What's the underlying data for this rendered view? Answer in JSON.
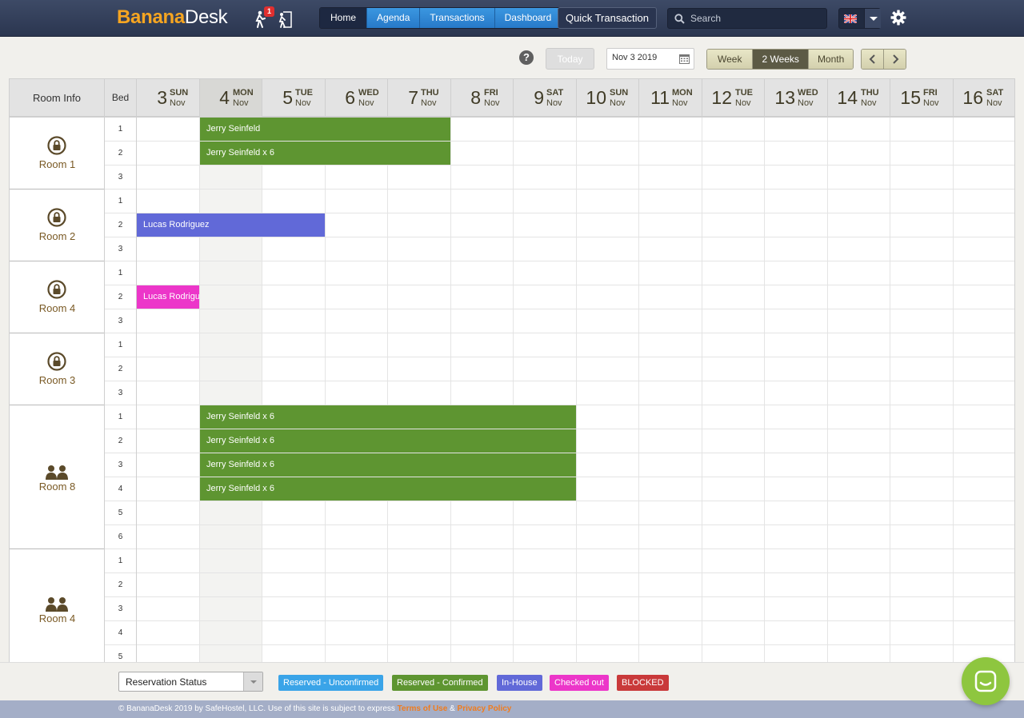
{
  "brand": {
    "part1": "Banana",
    "part2": "Desk"
  },
  "header": {
    "arrivals_badge": "1",
    "nav": [
      {
        "label": "Home",
        "active": true
      },
      {
        "label": "Agenda",
        "active": false
      },
      {
        "label": "Transactions",
        "active": false
      },
      {
        "label": "Dashboard",
        "active": false
      }
    ],
    "quick_transaction": "Quick Transaction",
    "search_placeholder": "Search",
    "language_icon": "uk-flag-icon"
  },
  "toolbar": {
    "help": "?",
    "today": "Today",
    "date_value": "Nov 3 2019",
    "views": [
      {
        "label": "Week",
        "active": false
      },
      {
        "label": "2 Weeks",
        "active": true
      },
      {
        "label": "Month",
        "active": false
      }
    ]
  },
  "calendar": {
    "room_info_header": "Room Info",
    "bed_header": "Bed",
    "days": [
      {
        "num": "3",
        "dow": "SUN",
        "mon": "Nov",
        "today": false
      },
      {
        "num": "4",
        "dow": "MON",
        "mon": "Nov",
        "today": true
      },
      {
        "num": "5",
        "dow": "TUE",
        "mon": "Nov",
        "today": false
      },
      {
        "num": "6",
        "dow": "WED",
        "mon": "Nov",
        "today": false
      },
      {
        "num": "7",
        "dow": "THU",
        "mon": "Nov",
        "today": false
      },
      {
        "num": "8",
        "dow": "FRI",
        "mon": "Nov",
        "today": false
      },
      {
        "num": "9",
        "dow": "SAT",
        "mon": "Nov",
        "today": false
      },
      {
        "num": "10",
        "dow": "SUN",
        "mon": "Nov",
        "today": false
      },
      {
        "num": "11",
        "dow": "MON",
        "mon": "Nov",
        "today": false
      },
      {
        "num": "12",
        "dow": "TUE",
        "mon": "Nov",
        "today": false
      },
      {
        "num": "13",
        "dow": "WED",
        "mon": "Nov",
        "today": false
      },
      {
        "num": "14",
        "dow": "THU",
        "mon": "Nov",
        "today": false
      },
      {
        "num": "15",
        "dow": "FRI",
        "mon": "Nov",
        "today": false
      },
      {
        "num": "16",
        "dow": "SAT",
        "mon": "Nov",
        "today": false
      }
    ],
    "rooms": [
      {
        "name": "Room 1",
        "icon": "lock-icon",
        "beds": [
          "1",
          "2",
          "3"
        ]
      },
      {
        "name": "Room 2",
        "icon": "lock-icon",
        "beds": [
          "1",
          "2",
          "3"
        ]
      },
      {
        "name": "Room 4",
        "icon": "lock-icon",
        "beds": [
          "1",
          "2",
          "3"
        ]
      },
      {
        "name": "Room 3",
        "icon": "lock-icon",
        "beds": [
          "1",
          "2",
          "3"
        ]
      },
      {
        "name": "Room 8",
        "icon": "people-icon",
        "beds": [
          "1",
          "2",
          "3",
          "4",
          "5",
          "6"
        ]
      },
      {
        "name": "Room 4",
        "icon": "people-icon",
        "beds": [
          "1",
          "2",
          "3",
          "4",
          "5"
        ]
      }
    ],
    "reservations": [
      {
        "guest": "Jerry Seinfeld",
        "room": 0,
        "bed": 0,
        "start_day": 1,
        "days": 4,
        "status": "confirmed"
      },
      {
        "guest": "Jerry Seinfeld x 6",
        "room": 0,
        "bed": 1,
        "start_day": 1,
        "days": 4,
        "status": "confirmed"
      },
      {
        "guest": "Lucas Rodriguez",
        "room": 1,
        "bed": 1,
        "start_day": 0,
        "days": 3,
        "status": "inhouse"
      },
      {
        "guest": "Lucas Rodriguez",
        "room": 2,
        "bed": 1,
        "start_day": 0,
        "days": 1,
        "status": "checkedout"
      },
      {
        "guest": "Jerry Seinfeld x 6",
        "room": 4,
        "bed": 0,
        "start_day": 1,
        "days": 6,
        "status": "confirmed"
      },
      {
        "guest": "Jerry Seinfeld x 6",
        "room": 4,
        "bed": 1,
        "start_day": 1,
        "days": 6,
        "status": "confirmed"
      },
      {
        "guest": "Jerry Seinfeld x 6",
        "room": 4,
        "bed": 2,
        "start_day": 1,
        "days": 6,
        "status": "confirmed"
      },
      {
        "guest": "Jerry Seinfeld x 6",
        "room": 4,
        "bed": 3,
        "start_day": 1,
        "days": 6,
        "status": "confirmed"
      }
    ]
  },
  "legend": {
    "status_select": "Reservation Status",
    "items": [
      {
        "label": "Reserved - Unconfirmed",
        "color": "#3aa4e8"
      },
      {
        "label": "Reserved - Confirmed",
        "color": "#5e9531"
      },
      {
        "label": "In-House",
        "color": "#6169d8"
      },
      {
        "label": "Checked out",
        "color": "#ec36c9"
      },
      {
        "label": "BLOCKED",
        "color": "#c9393a"
      }
    ]
  },
  "footer": {
    "text": "© BananaDesk 2019 by SafeHostel, LLC. Use of this site is subject to express ",
    "terms": "Terms of Use",
    "amp": " & ",
    "privacy": "Privacy Policy"
  }
}
